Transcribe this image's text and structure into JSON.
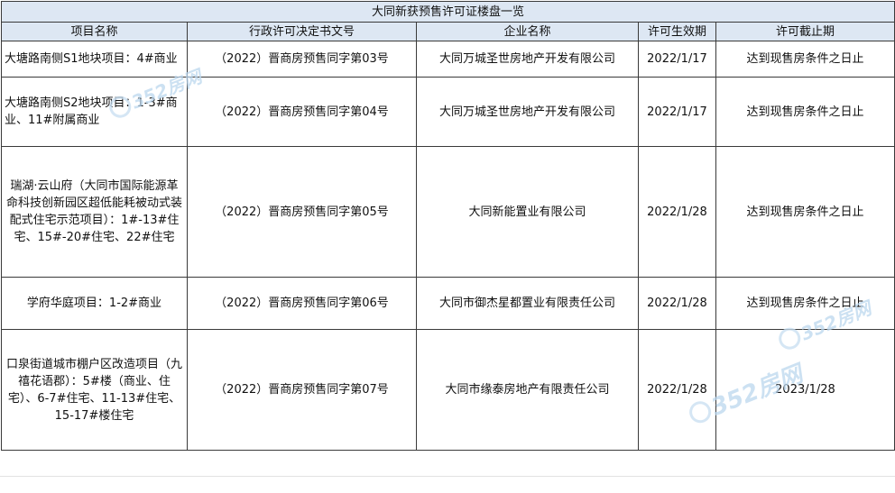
{
  "sheet": {
    "title": "大同新获预售许可证楼盘一览",
    "columns": [
      "项目名称",
      "行政许可决定书文号",
      "企业名称",
      "许可生效期",
      "许可截止期"
    ],
    "rows": [
      {
        "project": "大塘路南侧S1地块项目：4#商业",
        "license_no": "（2022）晋商房预售同字第03号",
        "company": "大同万城圣世房地产开发有限公司",
        "effective": "2022/1/17",
        "expiry": "达到现售房条件之日止"
      },
      {
        "project": "大塘路南侧S2地块项目：1-3#商业、11#附属商业",
        "license_no": "（2022）晋商房预售同字第04号",
        "company": "大同万城圣世房地产开发有限公司",
        "effective": "2022/1/17",
        "expiry": "达到现售房条件之日止"
      },
      {
        "project": "瑞湖·云山府（大同市国际能源革命科技创新园区超低能耗被动式装配式住宅示范项目）：1#-13#住宅、15#-20#住宅、22#住宅",
        "license_no": "（2022）晋商房预售同字第05号",
        "company": "大同新能置业有限公司",
        "effective": "2022/1/28",
        "expiry": "达到现售房条件之日止"
      },
      {
        "project": "学府华庭项目：1-2#商业",
        "license_no": "（2022）晋商房预售同字第06号",
        "company": "大同市御杰星都置业有限责任公司",
        "effective": "2022/1/28",
        "expiry": "达到现售房条件之日止"
      },
      {
        "project": "口泉街道城市棚户区改造项目（九禧花语郡）：5#楼（商业、住宅）、6-7#住宅、11-13#住宅、15-17#楼住宅",
        "license_no": "（2022）晋商房预售同字第07号",
        "company": "大同市缘泰房地产有限责任公司",
        "effective": "2022/1/28",
        "expiry": "2023/1/28"
      }
    ]
  },
  "watermark": {
    "text": "352房网"
  }
}
